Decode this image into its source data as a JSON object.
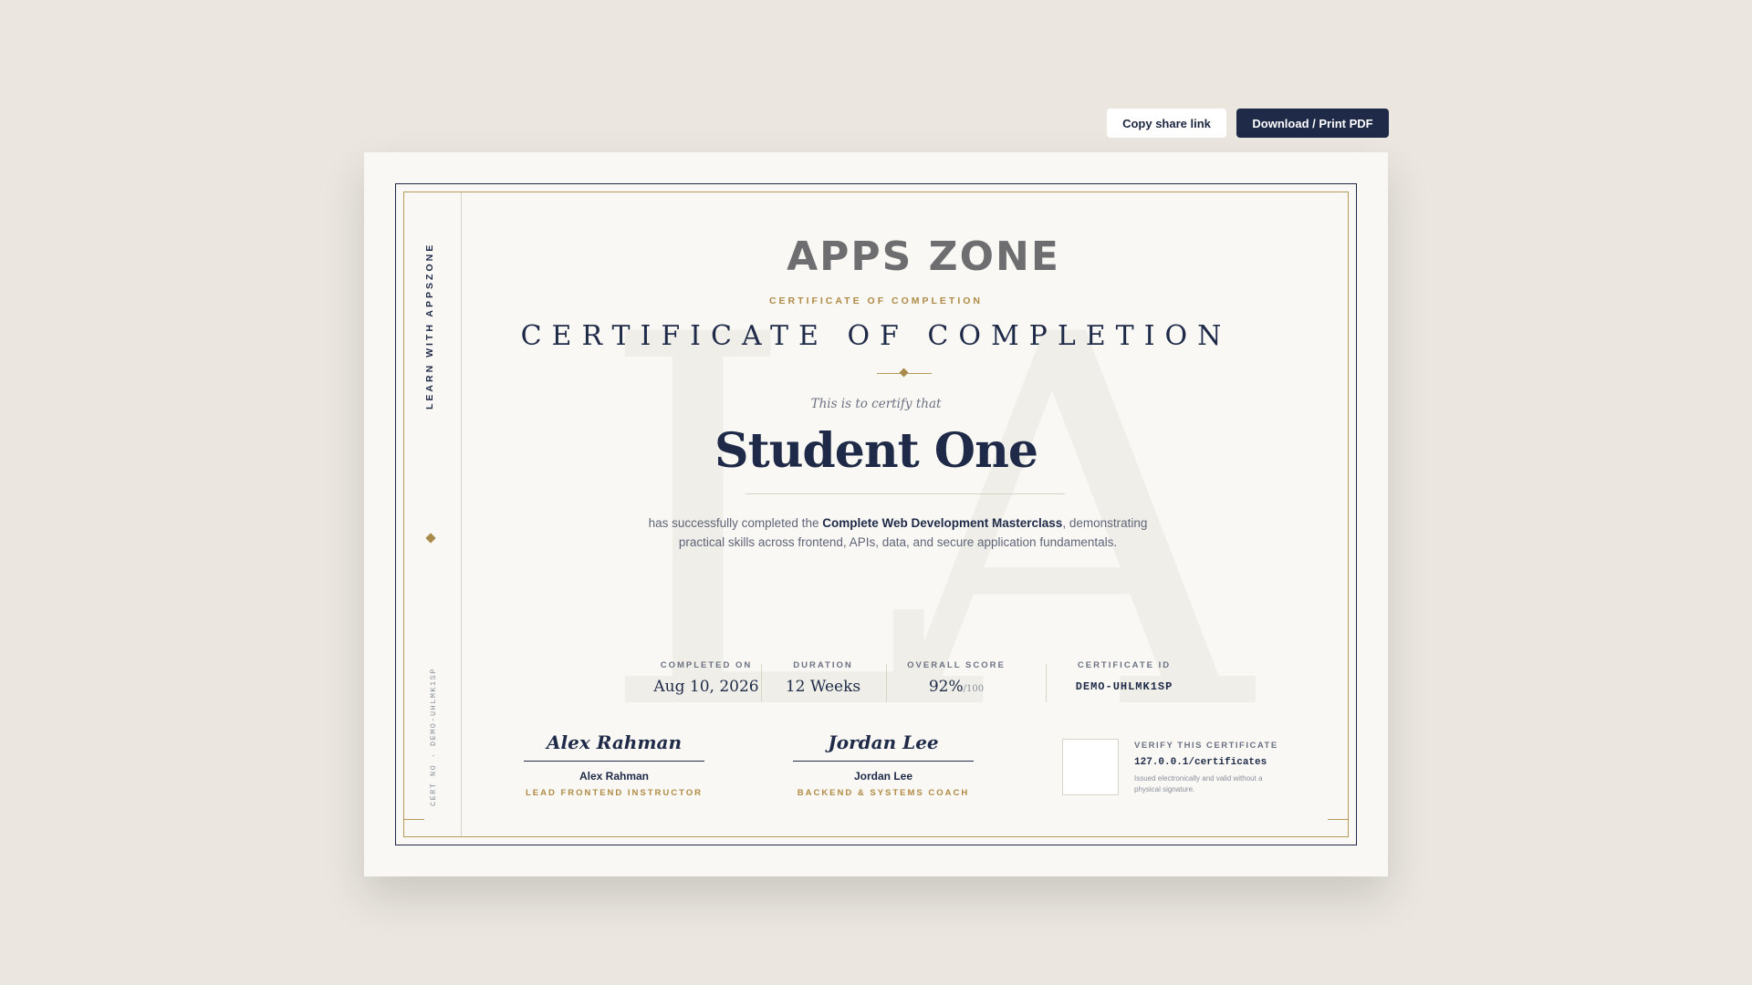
{
  "toolbar": {
    "copy_label": "Copy share link",
    "download_label": "Download / Print PDF"
  },
  "sidebar": {
    "label": "LEARN WITH APPSZONE",
    "cert_no": "CERT NO · DEMO-UHLMK1SP"
  },
  "watermark": "LA",
  "brand": {
    "logo_text": "APPS ZONE"
  },
  "certificate": {
    "eyebrow": "CERTIFICATE OF COMPLETION",
    "headline": "CERTIFICATE OF COMPLETION",
    "intro": "This is to certify that",
    "student_name": "Student One",
    "body_prefix": "has successfully completed the ",
    "course_name": "Complete Web Development Masterclass",
    "body_suffix": ", demonstrating practical skills across frontend, APIs, data, and secure application fundamentals."
  },
  "stats": {
    "completed_label": "COMPLETED ON",
    "completed_value": "Aug 10, 2026",
    "duration_label": "DURATION",
    "duration_value": "12 Weeks",
    "score_label": "OVERALL SCORE",
    "score_value": "92%",
    "score_unit": "/100",
    "id_label": "CERTIFICATE ID",
    "id_value": "DEMO-UHLMK1SP"
  },
  "signatures": [
    {
      "script": "Alex Rahman",
      "name": "Alex Rahman",
      "role": "LEAD FRONTEND INSTRUCTOR"
    },
    {
      "script": "Jordan Lee",
      "name": "Jordan Lee",
      "role": "BACKEND & SYSTEMS COACH"
    }
  ],
  "verify": {
    "label": "VERIFY THIS CERTIFICATE",
    "url": "127.0.0.1/certificates",
    "note": "Issued electronically and valid without a physical signature."
  },
  "colors": {
    "navy": "#1e2a48",
    "gold": "#b08a45",
    "paper": "#f9f8f4",
    "background": "#ebe7e0"
  }
}
